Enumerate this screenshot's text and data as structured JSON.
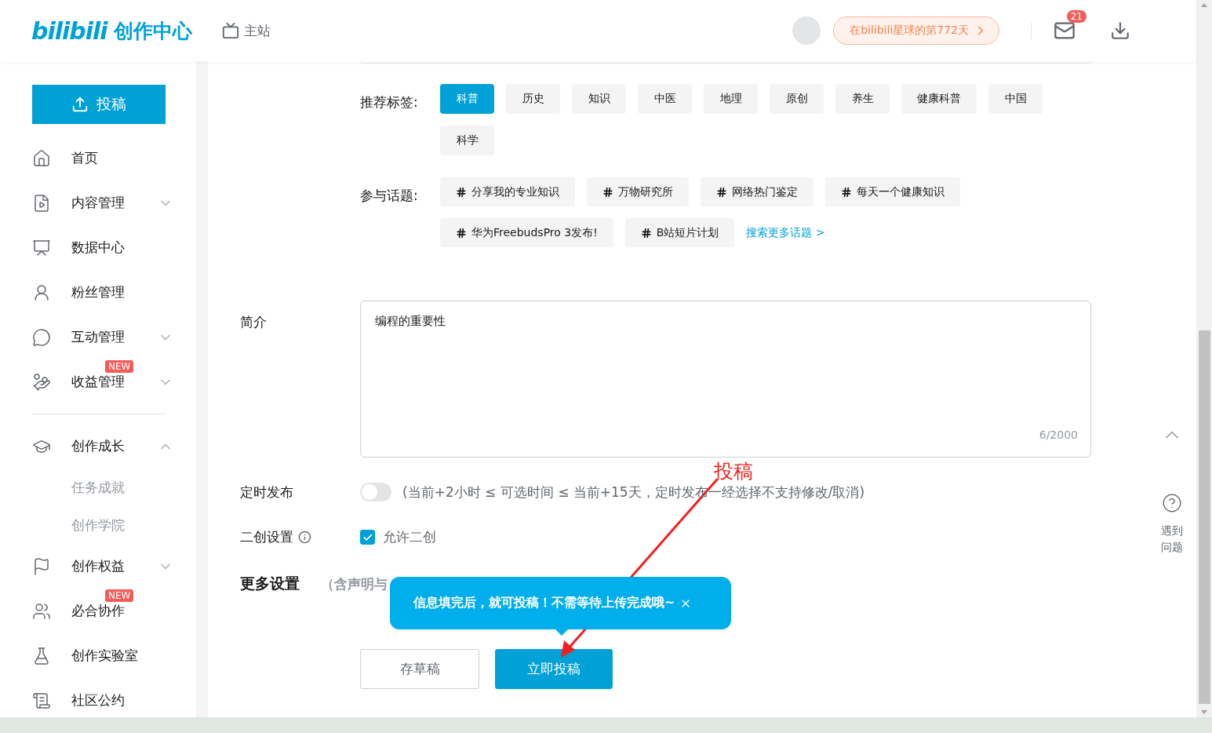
{
  "header": {
    "logo": "bilibili",
    "logo_title": "创作中心",
    "main_site": "主站",
    "days_pill": "在bilibili星球的第772天",
    "mail_badge": "21"
  },
  "sidebar": {
    "upload_button": "投稿",
    "items": [
      {
        "label": "首页"
      },
      {
        "label": "内容管理",
        "expanded": false
      },
      {
        "label": "数据中心"
      },
      {
        "label": "粉丝管理"
      },
      {
        "label": "互动管理",
        "expanded": false
      },
      {
        "label": "收益管理",
        "expanded": false,
        "badge": "NEW"
      },
      {
        "label": "创作成长",
        "expanded": true,
        "children": [
          {
            "label": "任务成就"
          },
          {
            "label": "创作学院"
          }
        ]
      },
      {
        "label": "创作权益",
        "expanded": false
      },
      {
        "label": "必合协作",
        "badge": "NEW"
      },
      {
        "label": "创作实验室"
      },
      {
        "label": "社区公约"
      }
    ]
  },
  "form": {
    "tags_label": "推荐标签:",
    "tags": [
      {
        "label": "科普",
        "selected": true
      },
      {
        "label": "历史",
        "selected": false
      },
      {
        "label": "知识",
        "selected": false
      },
      {
        "label": "中医",
        "selected": false
      },
      {
        "label": "地理",
        "selected": false
      },
      {
        "label": "原创",
        "selected": false
      },
      {
        "label": "养生",
        "selected": false
      },
      {
        "label": "健康科普",
        "selected": false
      },
      {
        "label": "中国",
        "selected": false
      },
      {
        "label": "科学",
        "selected": false
      }
    ],
    "topics_label": "参与话题:",
    "topics": [
      "分享我的专业知识",
      "万物研究所",
      "网络热门鉴定",
      "每天一个健康知识",
      "华为FreebudsPro 3发布!",
      "B站短片计划"
    ],
    "more_topics": "搜索更多话题 >",
    "intro_label": "简介",
    "intro_value": "编程的重要性",
    "intro_count": "6/2000",
    "schedule_label": "定时发布",
    "schedule_on": false,
    "schedule_hint": "(当前+2小时 ≤ 可选时间 ≤ 当前+15天，定时发布一经选择不支持修改/取消)",
    "remix_label": "二创设置",
    "remix_checked": true,
    "remix_option": "允许二创",
    "more_label": "更多设置",
    "more_hint": "（含声明与",
    "tooltip": "信息填完后，就可投稿！不需等待上传完成哦~",
    "draft_button": "存草稿",
    "submit_button": "立即投稿"
  },
  "annotation": {
    "text": "投稿"
  },
  "help": {
    "text": "遇到问题"
  }
}
